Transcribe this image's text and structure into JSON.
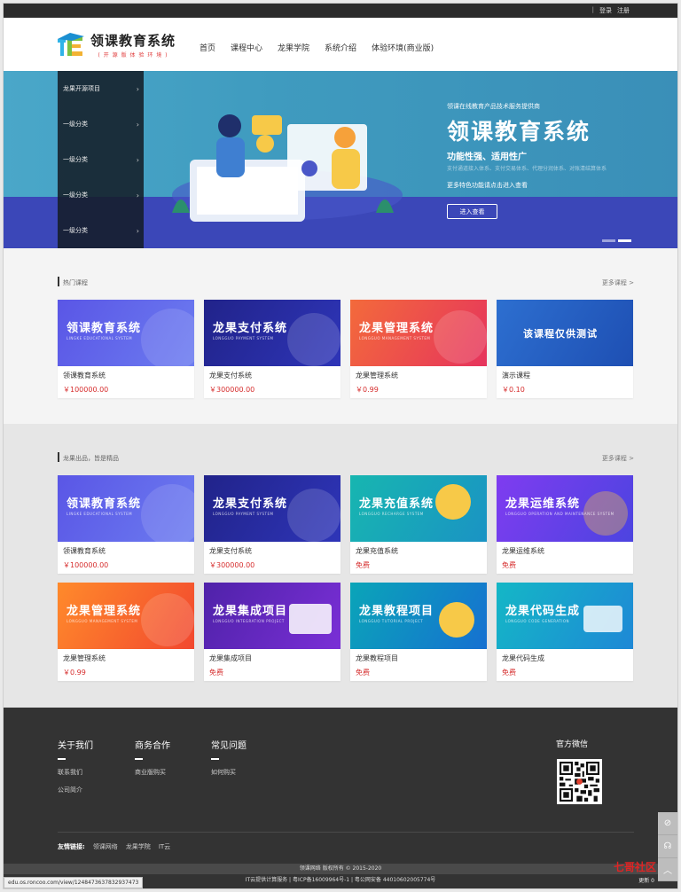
{
  "topbar": {
    "login": "登录",
    "register": "注册"
  },
  "logo": {
    "title": "领课教育系统",
    "subtitle": "( 开 源 版 体 验 环 境 )"
  },
  "nav": [
    "首页",
    "课程中心",
    "龙果学院",
    "系统介绍",
    "体验环境(商业版)"
  ],
  "side_menu": [
    "龙果开源项目",
    "一级分类",
    "一级分类",
    "一级分类",
    "一级分类"
  ],
  "banner": {
    "small": "领课在线教育产品技术服务提供商",
    "title": "领课教育系统",
    "subtitle": "功能性强、适用性广",
    "subtitle2": "支付通道接入体系、支付交易体系、代理分润体系、对账清结算体系",
    "more": "更多特色功能请点击进入查看",
    "button": "进入查看"
  },
  "hot": {
    "title": "热门课程",
    "more": "更多课程 >",
    "cards": [
      {
        "thumb_title": "领课教育系统",
        "thumb_sub": "LINGKE EDUCATIONAL SYSTEM",
        "name": "领课教育系统",
        "price": "￥100000.00",
        "color": "purple"
      },
      {
        "thumb_title": "龙果支付系统",
        "thumb_sub": "LONGGUO PAYMENT SYSTEM",
        "name": "龙果支付系统",
        "price": "￥300000.00",
        "color": "navy"
      },
      {
        "thumb_title": "龙果管理系统",
        "thumb_sub": "LONGGUO MANAGEMENT SYSTEM",
        "name": "龙果管理系统",
        "price": "￥0.99",
        "color": "red"
      },
      {
        "thumb_title": "该课程仅供测试",
        "thumb_sub": "",
        "name": "演示课程",
        "price": "￥0.10",
        "color": "blue"
      }
    ]
  },
  "featured": {
    "title": "龙果出品，皆是精品",
    "more": "更多课程 >",
    "cards": [
      {
        "thumb_title": "领课教育系统",
        "thumb_sub": "LINGKE EDUCATIONAL SYSTEM",
        "name": "领课教育系统",
        "price": "￥100000.00",
        "color": "purple"
      },
      {
        "thumb_title": "龙果支付系统",
        "thumb_sub": "LONGGUO PAYMENT SYSTEM",
        "name": "龙果支付系统",
        "price": "￥300000.00",
        "color": "navy"
      },
      {
        "thumb_title": "龙果充值系统",
        "thumb_sub": "LONGGUO RECHARGE SYSTEM",
        "name": "龙果充值系统",
        "price": "免费",
        "color": "teal"
      },
      {
        "thumb_title": "龙果运维系统",
        "thumb_sub": "LONGGUO OPERATION AND MAINTENANCE SYSTEM",
        "name": "龙果运维系统",
        "price": "免费",
        "color": "violet"
      },
      {
        "thumb_title": "龙果管理系统",
        "thumb_sub": "LONGGUO MANAGEMENT SYSTEM",
        "name": "龙果管理系统",
        "price": "￥0.99",
        "color": "orange"
      },
      {
        "thumb_title": "龙果集成项目",
        "thumb_sub": "LONGGUO INTEGRATION PROJECT",
        "name": "龙果集成项目",
        "price": "免费",
        "color": "deepviolet"
      },
      {
        "thumb_title": "龙果教程项目",
        "thumb_sub": "LONGGUO TUTORIAL PROJECT",
        "name": "龙果教程项目",
        "price": "免费",
        "color": "cyan"
      },
      {
        "thumb_title": "龙果代码生成",
        "thumb_sub": "LONGGUO CODE GENERATION",
        "name": "龙果代码生成",
        "price": "免费",
        "color": "aqua"
      }
    ]
  },
  "footer": {
    "about": {
      "title": "关于我们",
      "links": [
        "联系我们",
        "公司简介"
      ]
    },
    "business": {
      "title": "商务合作",
      "links": [
        "商业版购买"
      ]
    },
    "faq": {
      "title": "常见问题",
      "links": [
        "如何购买"
      ]
    },
    "wechat": "官方微信",
    "friends_label": "友情链接:",
    "friends": [
      "领课网络",
      "龙果学院",
      "IT云"
    ],
    "copyright": "领课网络 版权所有 © 2015-2020",
    "icp": "IT云提供计算服务  |  粤ICP备16009964号-1  |  粤公网安备 44010602005774号"
  },
  "status_url": "edu.os.roncoo.com/view/1248473637832937473",
  "watermark": "七哥社区",
  "watermark_sub": "更新 0"
}
